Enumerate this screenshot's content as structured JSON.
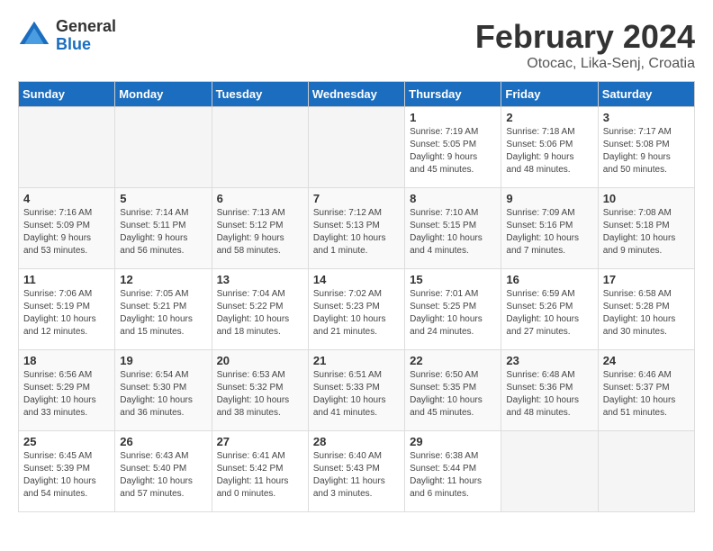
{
  "header": {
    "logo_general": "General",
    "logo_blue": "Blue",
    "month_title": "February 2024",
    "location": "Otocac, Lika-Senj, Croatia"
  },
  "calendar": {
    "days_of_week": [
      "Sunday",
      "Monday",
      "Tuesday",
      "Wednesday",
      "Thursday",
      "Friday",
      "Saturday"
    ],
    "weeks": [
      [
        {
          "day": "",
          "info": ""
        },
        {
          "day": "",
          "info": ""
        },
        {
          "day": "",
          "info": ""
        },
        {
          "day": "",
          "info": ""
        },
        {
          "day": "1",
          "info": "Sunrise: 7:19 AM\nSunset: 5:05 PM\nDaylight: 9 hours\nand 45 minutes."
        },
        {
          "day": "2",
          "info": "Sunrise: 7:18 AM\nSunset: 5:06 PM\nDaylight: 9 hours\nand 48 minutes."
        },
        {
          "day": "3",
          "info": "Sunrise: 7:17 AM\nSunset: 5:08 PM\nDaylight: 9 hours\nand 50 minutes."
        }
      ],
      [
        {
          "day": "4",
          "info": "Sunrise: 7:16 AM\nSunset: 5:09 PM\nDaylight: 9 hours\nand 53 minutes."
        },
        {
          "day": "5",
          "info": "Sunrise: 7:14 AM\nSunset: 5:11 PM\nDaylight: 9 hours\nand 56 minutes."
        },
        {
          "day": "6",
          "info": "Sunrise: 7:13 AM\nSunset: 5:12 PM\nDaylight: 9 hours\nand 58 minutes."
        },
        {
          "day": "7",
          "info": "Sunrise: 7:12 AM\nSunset: 5:13 PM\nDaylight: 10 hours\nand 1 minute."
        },
        {
          "day": "8",
          "info": "Sunrise: 7:10 AM\nSunset: 5:15 PM\nDaylight: 10 hours\nand 4 minutes."
        },
        {
          "day": "9",
          "info": "Sunrise: 7:09 AM\nSunset: 5:16 PM\nDaylight: 10 hours\nand 7 minutes."
        },
        {
          "day": "10",
          "info": "Sunrise: 7:08 AM\nSunset: 5:18 PM\nDaylight: 10 hours\nand 9 minutes."
        }
      ],
      [
        {
          "day": "11",
          "info": "Sunrise: 7:06 AM\nSunset: 5:19 PM\nDaylight: 10 hours\nand 12 minutes."
        },
        {
          "day": "12",
          "info": "Sunrise: 7:05 AM\nSunset: 5:21 PM\nDaylight: 10 hours\nand 15 minutes."
        },
        {
          "day": "13",
          "info": "Sunrise: 7:04 AM\nSunset: 5:22 PM\nDaylight: 10 hours\nand 18 minutes."
        },
        {
          "day": "14",
          "info": "Sunrise: 7:02 AM\nSunset: 5:23 PM\nDaylight: 10 hours\nand 21 minutes."
        },
        {
          "day": "15",
          "info": "Sunrise: 7:01 AM\nSunset: 5:25 PM\nDaylight: 10 hours\nand 24 minutes."
        },
        {
          "day": "16",
          "info": "Sunrise: 6:59 AM\nSunset: 5:26 PM\nDaylight: 10 hours\nand 27 minutes."
        },
        {
          "day": "17",
          "info": "Sunrise: 6:58 AM\nSunset: 5:28 PM\nDaylight: 10 hours\nand 30 minutes."
        }
      ],
      [
        {
          "day": "18",
          "info": "Sunrise: 6:56 AM\nSunset: 5:29 PM\nDaylight: 10 hours\nand 33 minutes."
        },
        {
          "day": "19",
          "info": "Sunrise: 6:54 AM\nSunset: 5:30 PM\nDaylight: 10 hours\nand 36 minutes."
        },
        {
          "day": "20",
          "info": "Sunrise: 6:53 AM\nSunset: 5:32 PM\nDaylight: 10 hours\nand 38 minutes."
        },
        {
          "day": "21",
          "info": "Sunrise: 6:51 AM\nSunset: 5:33 PM\nDaylight: 10 hours\nand 41 minutes."
        },
        {
          "day": "22",
          "info": "Sunrise: 6:50 AM\nSunset: 5:35 PM\nDaylight: 10 hours\nand 45 minutes."
        },
        {
          "day": "23",
          "info": "Sunrise: 6:48 AM\nSunset: 5:36 PM\nDaylight: 10 hours\nand 48 minutes."
        },
        {
          "day": "24",
          "info": "Sunrise: 6:46 AM\nSunset: 5:37 PM\nDaylight: 10 hours\nand 51 minutes."
        }
      ],
      [
        {
          "day": "25",
          "info": "Sunrise: 6:45 AM\nSunset: 5:39 PM\nDaylight: 10 hours\nand 54 minutes."
        },
        {
          "day": "26",
          "info": "Sunrise: 6:43 AM\nSunset: 5:40 PM\nDaylight: 10 hours\nand 57 minutes."
        },
        {
          "day": "27",
          "info": "Sunrise: 6:41 AM\nSunset: 5:42 PM\nDaylight: 11 hours\nand 0 minutes."
        },
        {
          "day": "28",
          "info": "Sunrise: 6:40 AM\nSunset: 5:43 PM\nDaylight: 11 hours\nand 3 minutes."
        },
        {
          "day": "29",
          "info": "Sunrise: 6:38 AM\nSunset: 5:44 PM\nDaylight: 11 hours\nand 6 minutes."
        },
        {
          "day": "",
          "info": ""
        },
        {
          "day": "",
          "info": ""
        }
      ]
    ]
  }
}
